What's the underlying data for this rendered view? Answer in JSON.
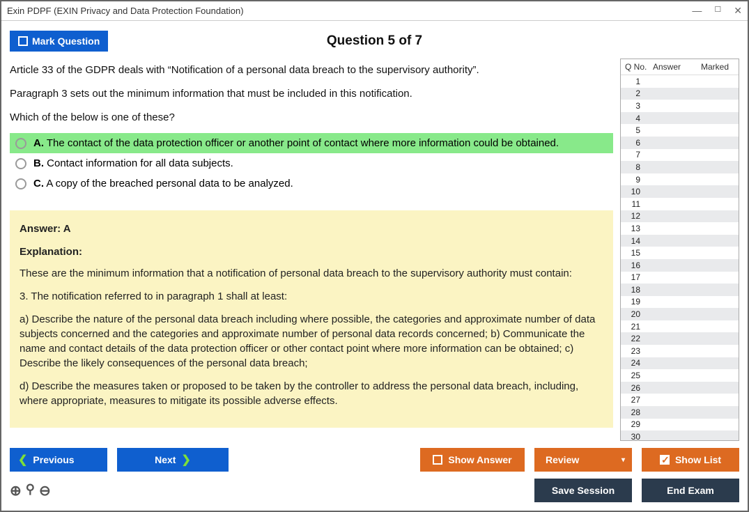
{
  "window": {
    "title": "Exin PDPF (EXIN Privacy and Data Protection Foundation)"
  },
  "header": {
    "mark_label": "Mark Question",
    "question_title": "Question 5 of 7"
  },
  "question": {
    "para1": "Article 33 of the GDPR deals with “Notification of a personal data breach to the supervisory authority”.",
    "para2": "Paragraph 3 sets out the minimum information that must be included in this notification.",
    "para3": "Which of the below is one of these?"
  },
  "options": {
    "a": {
      "letter": "A.",
      "text": " The contact of the data protection officer or another point of contact where more information could be obtained.",
      "correct": true
    },
    "b": {
      "letter": "B.",
      "text": " Contact information for all data subjects.",
      "correct": false
    },
    "c": {
      "letter": "C.",
      "text": " A copy of the breached personal data to be analyzed.",
      "correct": false
    }
  },
  "answer": {
    "heading": "Answer: A",
    "exp_heading": "Explanation:",
    "p1": "These are the minimum information that a notification of personal data breach to the supervisory authority must contain:",
    "p2": "3. The notification referred to in paragraph 1 shall at least:",
    "p3": "a) Describe the nature of the personal data breach including where possible, the categories and approximate number of data subjects concerned and the categories and approximate number of personal data records concerned; b) Communicate the name and contact details of the data protection officer or other contact point where more information can be obtained; c) Describe the likely consequences of the personal data breach;",
    "p4": "d) Describe the measures taken or proposed to be taken by the controller to address the personal data breach, including, where appropriate, measures to mitigate its possible adverse effects."
  },
  "sidepanel": {
    "col_q": "Q No.",
    "col_a": "Answer",
    "col_m": "Marked",
    "rows": 30
  },
  "buttons": {
    "previous": "Previous",
    "next": "Next",
    "show_answer": "Show Answer",
    "review": "Review",
    "show_list": "Show List",
    "save_session": "Save Session",
    "end_exam": "End Exam"
  }
}
